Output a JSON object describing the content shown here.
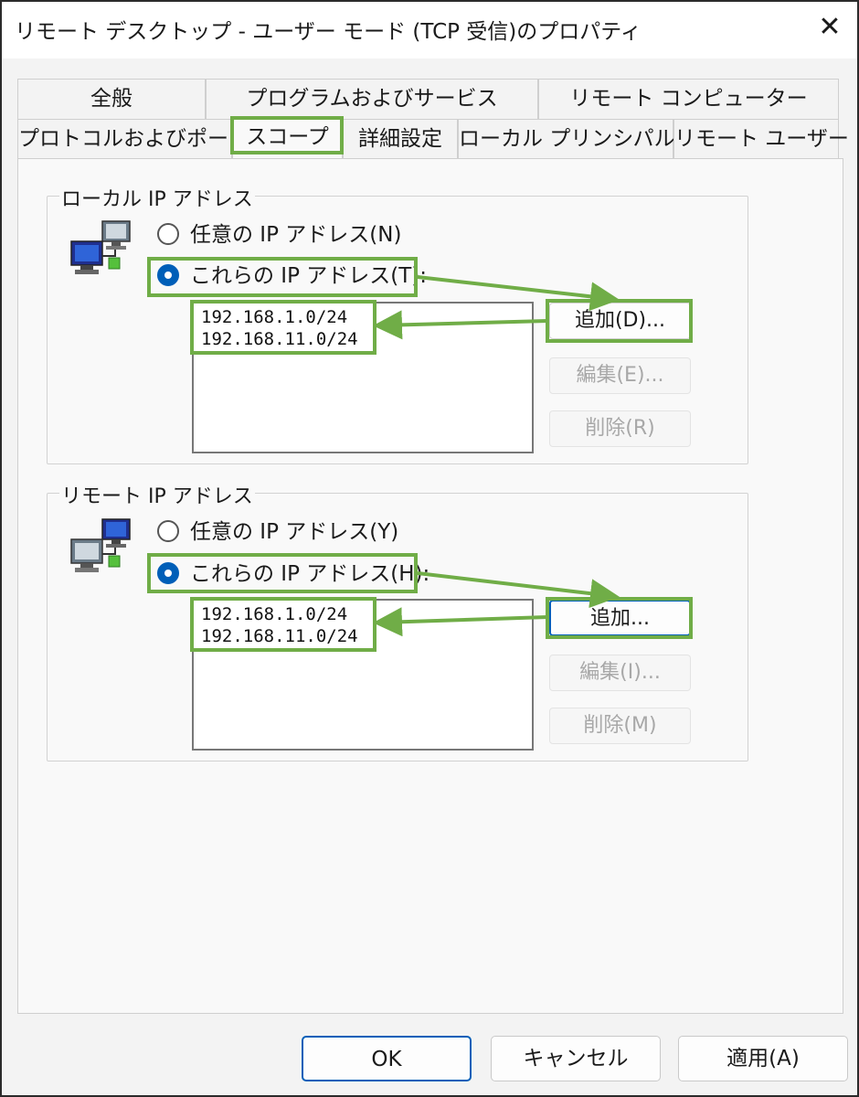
{
  "window": {
    "title": "リモート デスクトップ - ユーザー モード (TCP 受信)のプロパティ",
    "close_glyph": "✕"
  },
  "tabs": {
    "row1": [
      "全般",
      "プログラムおよびサービス",
      "リモート コンピューター"
    ],
    "row2": [
      "プロトコルおよびポート",
      "スコープ",
      "詳細設定",
      "ローカル プリンシパル",
      "リモート ユーザー"
    ],
    "active": "スコープ"
  },
  "local": {
    "group_label": "ローカル IP アドレス",
    "radio_any": "任意の IP アドレス(N)",
    "radio_these": "これらの IP アドレス(T):",
    "selected": "these",
    "addresses": [
      "192.168.1.0/24",
      "192.168.11.0/24"
    ],
    "add_label": "追加(D)...",
    "edit_label": "編集(E)...",
    "delete_label": "削除(R)",
    "icon": "network-computers-icon"
  },
  "remote": {
    "group_label": "リモート IP アドレス",
    "radio_any": "任意の IP アドレス(Y)",
    "radio_these": "これらの IP アドレス(H):",
    "selected": "these",
    "addresses": [
      "192.168.1.0/24",
      "192.168.11.0/24"
    ],
    "add_label": "追加...",
    "edit_label": "編集(I)...",
    "delete_label": "削除(M)",
    "icon": "network-computers-icon"
  },
  "footer": {
    "ok_label": "OK",
    "cancel_label": "キャンセル",
    "apply_label": "適用(A)"
  },
  "colors": {
    "highlight": "#70ad47",
    "accent": "#005fb8"
  }
}
